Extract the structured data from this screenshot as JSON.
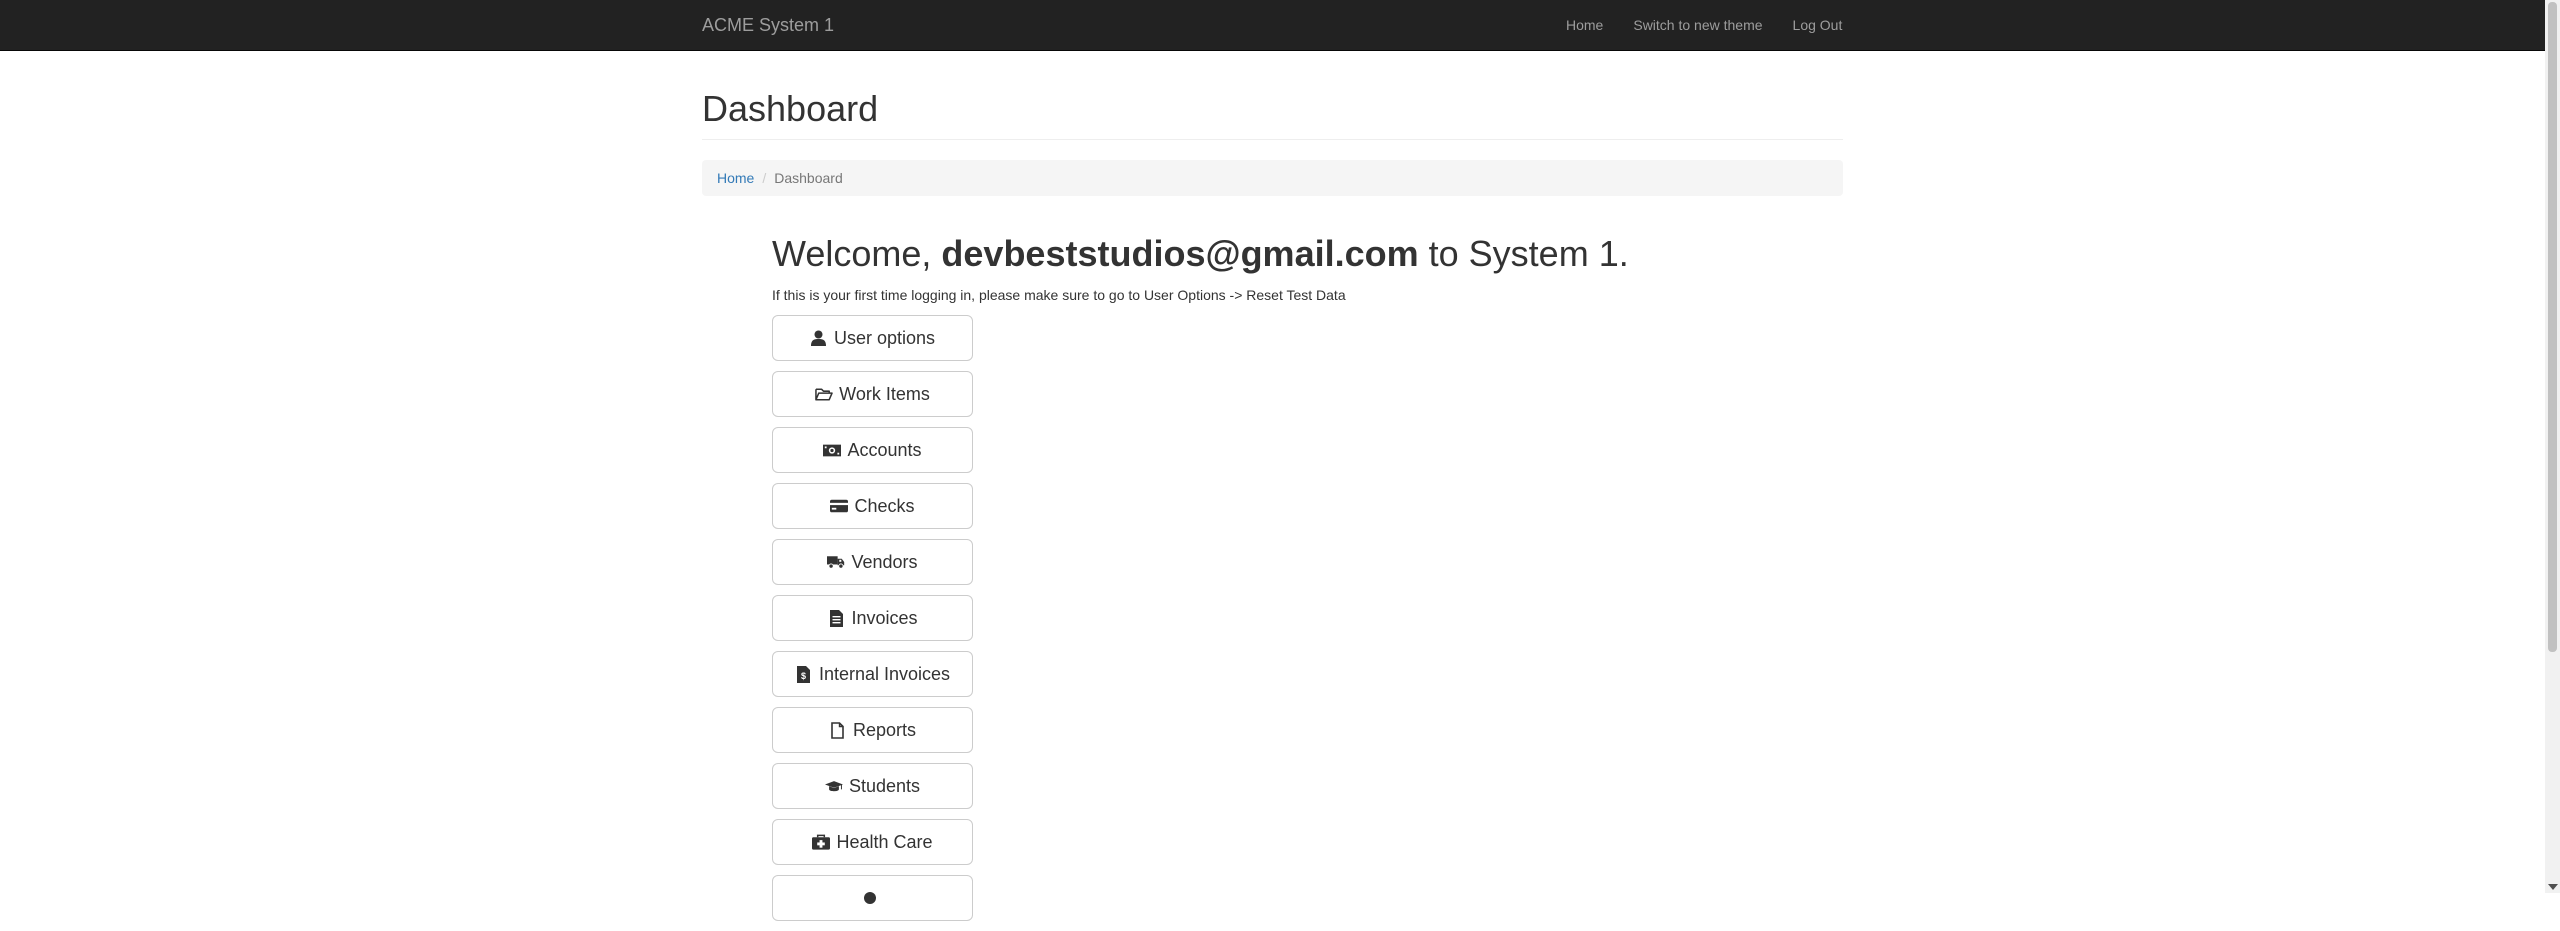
{
  "navbar": {
    "brand": "ACME System 1",
    "links": [
      "Home",
      "Switch to new theme",
      "Log Out"
    ]
  },
  "page": {
    "title": "Dashboard"
  },
  "breadcrumb": {
    "home": "Home",
    "separator": "/",
    "current": "Dashboard"
  },
  "welcome": {
    "prefix": "Welcome,",
    "user": "devbeststudios@gmail.com",
    "suffix": "to System 1."
  },
  "hint": "If this is your first time logging in, please make sure to go to User Options -> Reset Test Data",
  "buttons": [
    {
      "label": "User options",
      "icon": "user-icon"
    },
    {
      "label": "Work Items",
      "icon": "folder-open-icon"
    },
    {
      "label": "Accounts",
      "icon": "money-icon"
    },
    {
      "label": "Checks",
      "icon": "credit-card-icon"
    },
    {
      "label": "Vendors",
      "icon": "truck-icon"
    },
    {
      "label": "Invoices",
      "icon": "file-text-icon"
    },
    {
      "label": "Internal Invoices",
      "icon": "file-invoice-icon"
    },
    {
      "label": "Reports",
      "icon": "file-o-icon"
    },
    {
      "label": "Students",
      "icon": "graduation-cap-icon"
    },
    {
      "label": "Health Care",
      "icon": "medkit-icon"
    },
    {
      "label": "",
      "icon": "partial-icon"
    }
  ],
  "colors": {
    "navbar_bg": "#222222",
    "link_blue": "#337ab7",
    "breadcrumb_bg": "#f5f5f5"
  }
}
